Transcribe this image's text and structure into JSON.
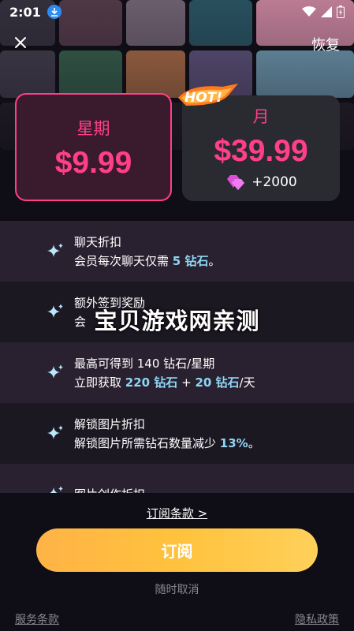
{
  "status_bar": {
    "time": "2:01"
  },
  "header": {
    "restore_label": "恢复"
  },
  "plans": [
    {
      "name": "星期",
      "price": "$9.99",
      "selected": true
    },
    {
      "name": "月",
      "price": "$39.99",
      "bonus": "+2000",
      "badge": "HOT!"
    }
  ],
  "features": [
    {
      "title": "聊天折扣",
      "desc": [
        "会员每次聊天仅需 ",
        "5 钻石",
        "。"
      ]
    },
    {
      "title": "额外签到奖励",
      "desc": [
        "会",
        "",
        ""
      ]
    },
    {
      "title": "最高可得到 140 钻石/星期",
      "desc": [
        "立即获取 ",
        "220 钻石",
        " + ",
        "20 钻石",
        "/天"
      ]
    },
    {
      "title": "解锁图片折扣",
      "desc": [
        "解锁图片所需钻石数量减少 ",
        "13%",
        "。"
      ]
    },
    {
      "title": "图片创作折扣"
    }
  ],
  "watermark": "宝贝游戏网亲测",
  "bottom": {
    "terms_link": "订阅条款 >",
    "subscribe_label": "订阅",
    "cancel_note": "随时取消",
    "footer_left": "服务条款",
    "footer_right": "隐私政策"
  },
  "colors": {
    "accent_pink": "#ff3f8a",
    "button_orange": "#ffc23d",
    "highlight_blue": "#8fd6f5"
  }
}
